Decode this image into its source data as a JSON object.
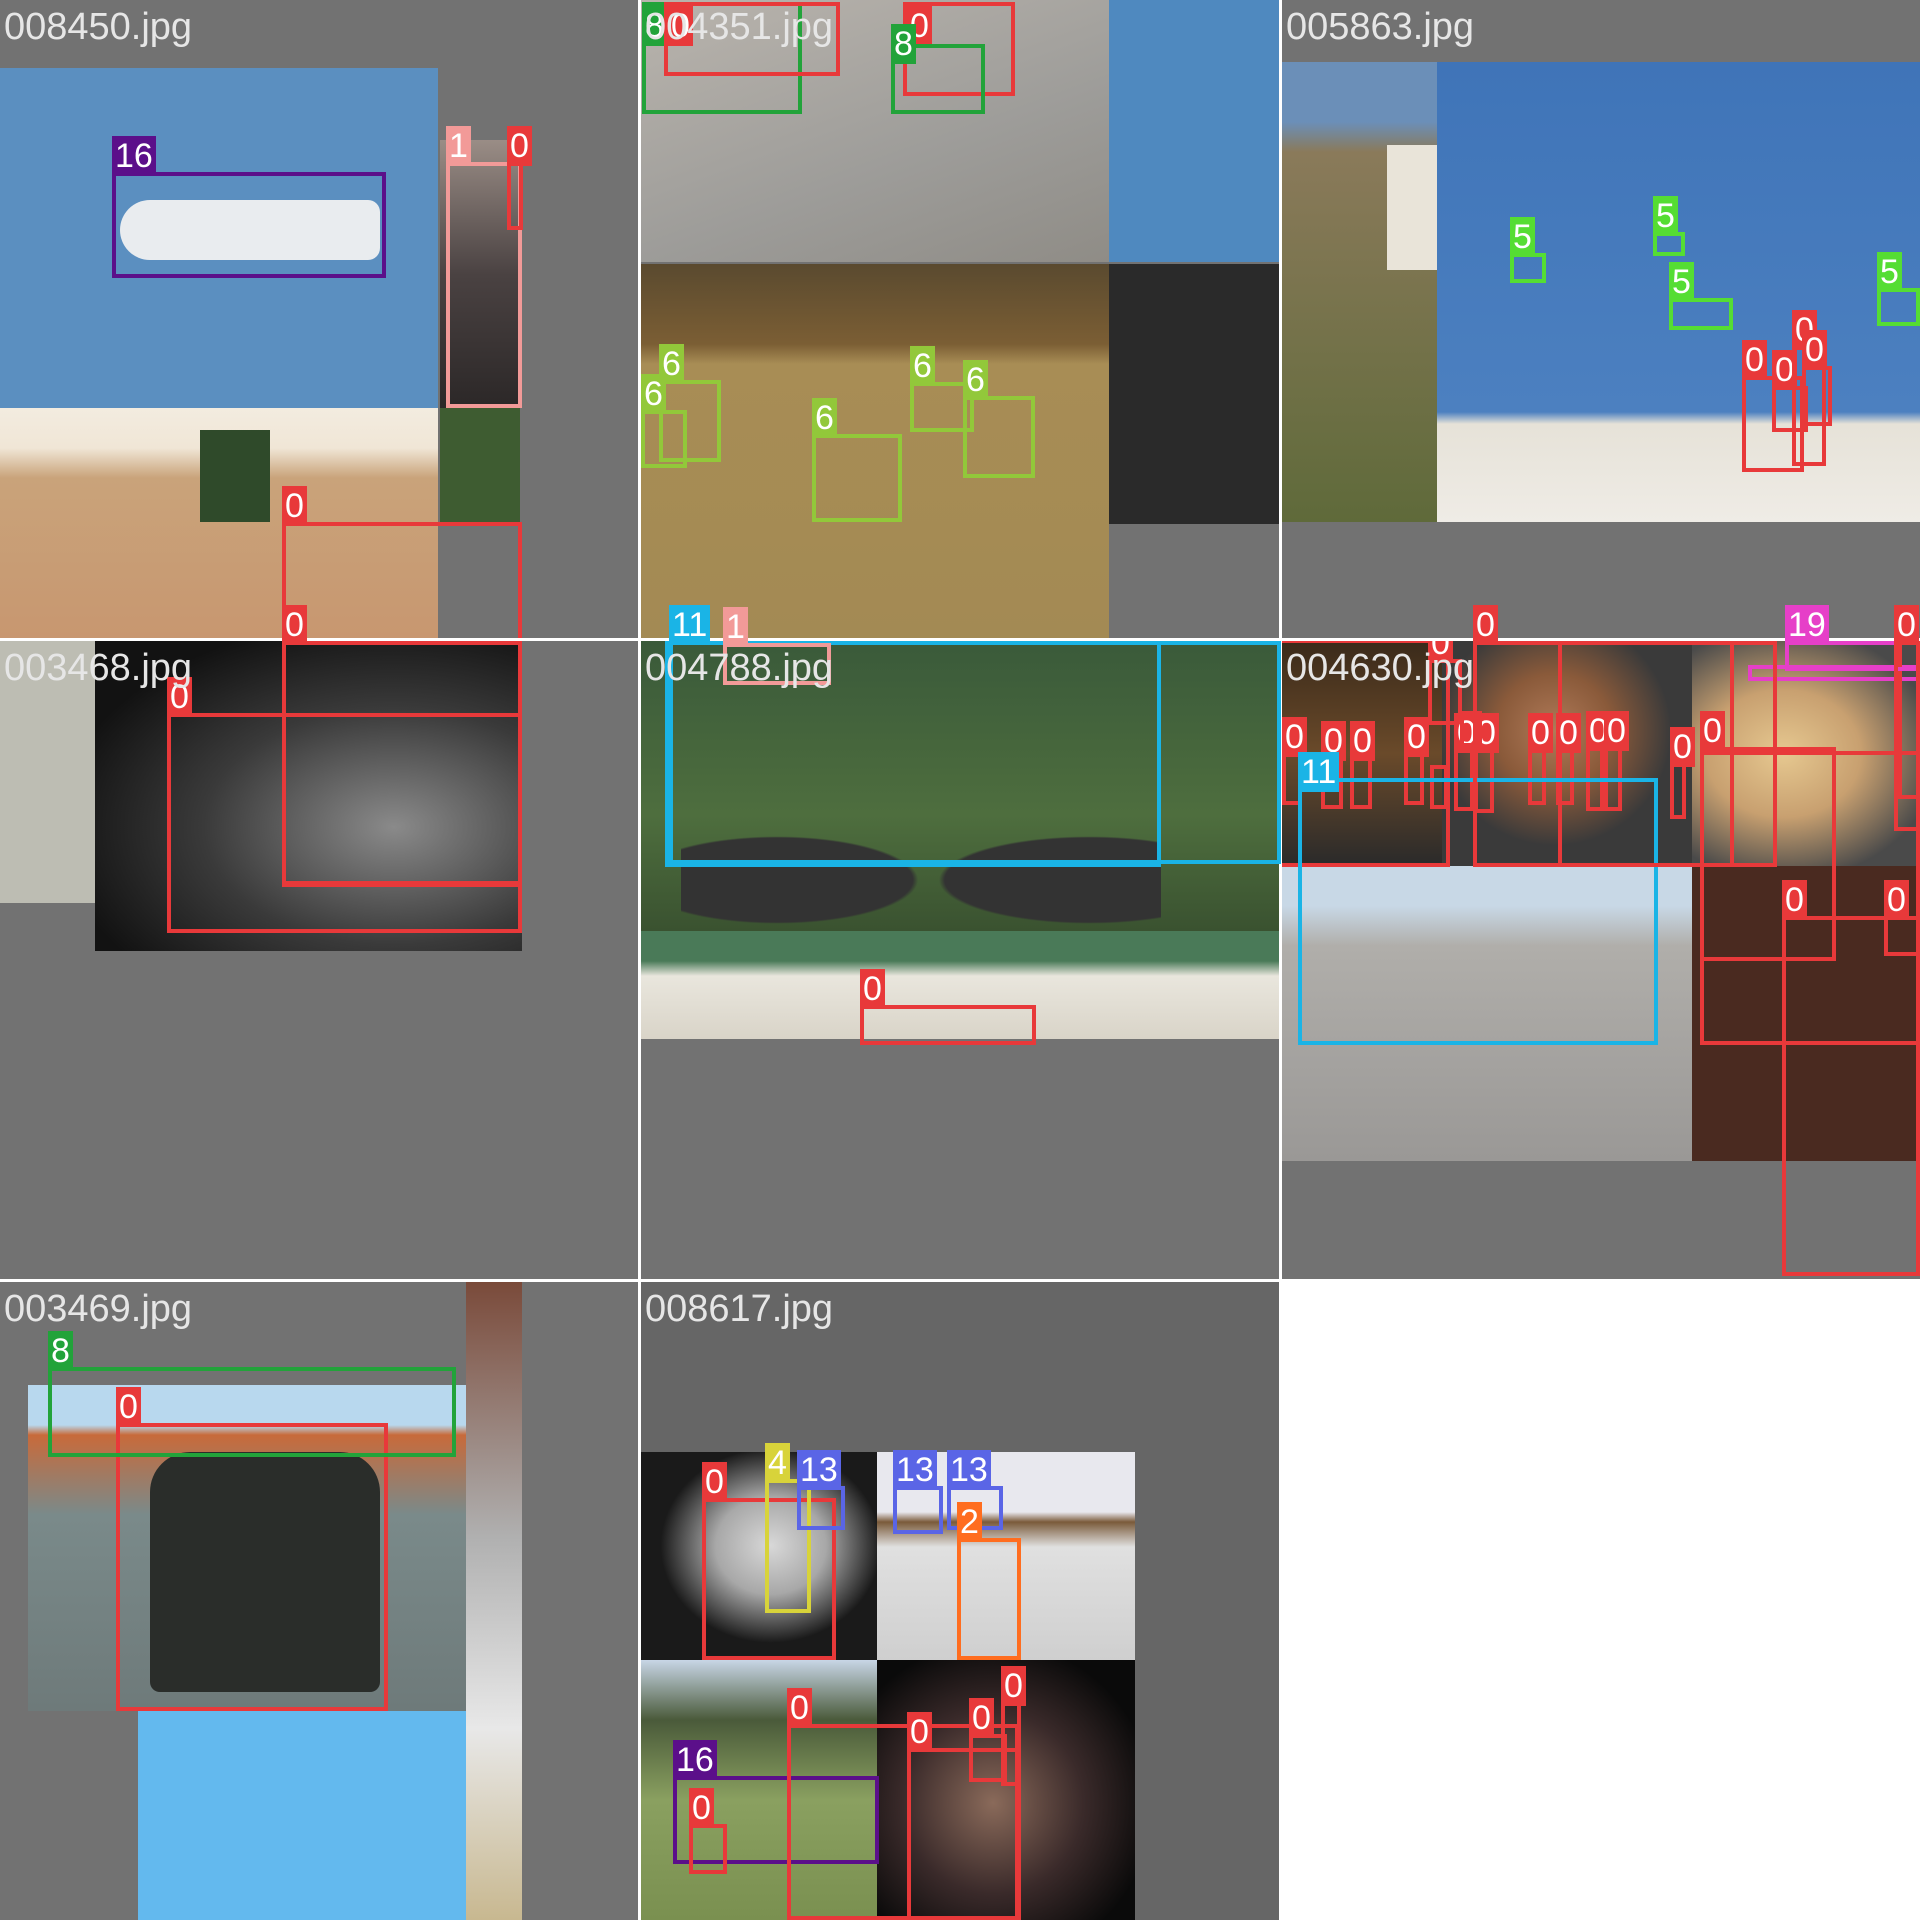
{
  "mosaic": {
    "tiles": [
      {
        "name": "tile-1",
        "filename": "008450.jpg"
      },
      {
        "name": "tile-2",
        "filename": "004351.jpg"
      },
      {
        "name": "tile-3",
        "filename": "005863.jpg"
      },
      {
        "name": "tile-4",
        "filename": "003468.jpg"
      },
      {
        "name": "tile-5",
        "filename": "004788.jpg"
      },
      {
        "name": "tile-6",
        "filename": "004630.jpg"
      },
      {
        "name": "tile-7",
        "filename": "003469.jpg"
      },
      {
        "name": "tile-8",
        "filename": "008617.jpg"
      }
    ]
  },
  "class_colors": {
    "0": "#e8393a",
    "1": "#f29a98",
    "2": "#ff6d1f",
    "4": "#d8d33a",
    "5": "#55dd33",
    "6": "#92c83a",
    "8": "#22a33a",
    "11": "#1ab4e6",
    "13": "#5a65e6",
    "16": "#5b0f8a",
    "19": "#e63fc8"
  },
  "labels": {
    "t1": [
      "16",
      "1",
      "0",
      "0"
    ],
    "t2": [
      "8",
      "0",
      "0",
      "8",
      "6",
      "6",
      "6",
      "6",
      "6"
    ],
    "t3": [
      "5",
      "5",
      "5",
      "5",
      "0",
      "0",
      "0",
      "0"
    ],
    "t4": [
      "0",
      "0"
    ],
    "t5": [
      "11",
      "1",
      "0"
    ],
    "t6": [
      "0",
      "19",
      "0",
      "0",
      "0",
      "0",
      "0",
      "0",
      "0",
      "0",
      "0",
      "0",
      "0",
      "0",
      "0",
      "0",
      "0",
      "0",
      "11"
    ],
    "t7": [
      "0",
      "8"
    ],
    "t8": [
      "0",
      "4",
      "13",
      "13",
      "13",
      "2",
      "16",
      "0",
      "0",
      "0",
      "0",
      "0"
    ]
  }
}
